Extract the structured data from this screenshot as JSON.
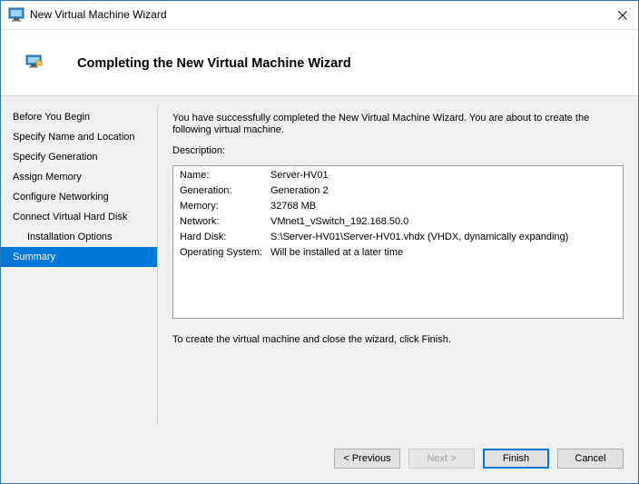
{
  "window": {
    "title": "New Virtual Machine Wizard",
    "accent": "#0078d7"
  },
  "header": {
    "title": "Completing the New Virtual Machine Wizard"
  },
  "nav": {
    "items": [
      {
        "label": "Before You Begin"
      },
      {
        "label": "Specify Name and Location"
      },
      {
        "label": "Specify Generation"
      },
      {
        "label": "Assign Memory"
      },
      {
        "label": "Configure Networking"
      },
      {
        "label": "Connect Virtual Hard Disk"
      },
      {
        "label": "Installation Options"
      },
      {
        "label": "Summary"
      }
    ],
    "selected": "Summary"
  },
  "main": {
    "intro": "You have successfully completed the New Virtual Machine Wizard. You are about to create the following virtual machine.",
    "description_label": "Description:",
    "description": [
      {
        "key": "Name:",
        "value": "Server-HV01"
      },
      {
        "key": "Generation:",
        "value": "Generation 2"
      },
      {
        "key": "Memory:",
        "value": "32768 MB"
      },
      {
        "key": "Network:",
        "value": "VMnet1_vSwitch_192.168.50.0"
      },
      {
        "key": "Hard Disk:",
        "value": "S:\\Server-HV01\\Server-HV01.vhdx (VHDX, dynamically expanding)"
      },
      {
        "key": "Operating System:",
        "value": "Will be installed at a later time"
      }
    ],
    "outro": "To create the virtual machine and close the wizard, click Finish."
  },
  "buttons": {
    "previous": "< Previous",
    "next": "Next >",
    "finish": "Finish",
    "cancel": "Cancel"
  }
}
